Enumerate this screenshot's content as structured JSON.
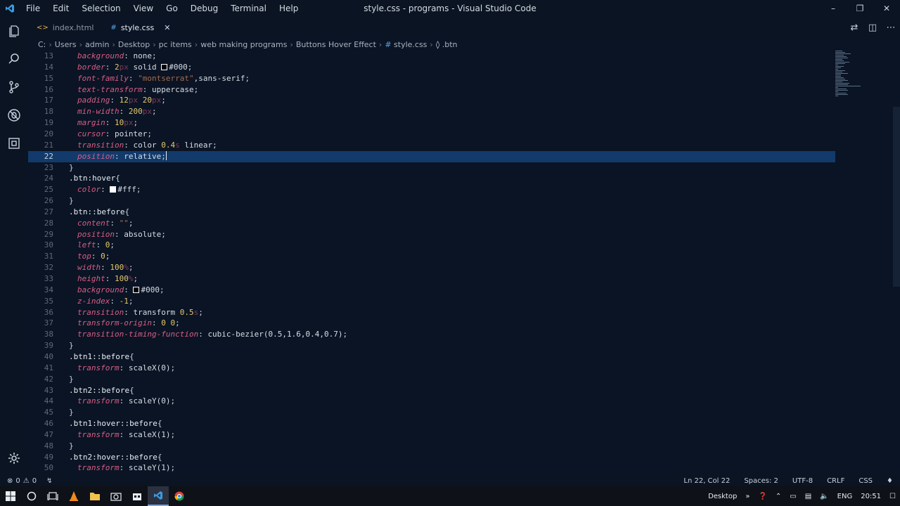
{
  "window": {
    "title": "style.css - programs - Visual Studio Code",
    "menu": [
      "File",
      "Edit",
      "Selection",
      "View",
      "Go",
      "Debug",
      "Terminal",
      "Help"
    ]
  },
  "tabs": [
    {
      "label": "index.html",
      "icon": "html-file-icon"
    },
    {
      "label": "style.css",
      "icon": "css-file-icon",
      "active": true
    }
  ],
  "breadcrumb": [
    "C:",
    "Users",
    "admin",
    "Desktop",
    "pc items",
    "web making programs",
    "Buttons Hover Effect",
    "style.css",
    ".btn"
  ],
  "editor": {
    "lines": [
      {
        "n": "13",
        "ind": 1,
        "t": [
          [
            "p",
            "background"
          ],
          [
            "x",
            ": "
          ],
          [
            "v",
            "none"
          ],
          [
            "x",
            ";"
          ]
        ]
      },
      {
        "n": "14",
        "ind": 1,
        "t": [
          [
            "p",
            "border"
          ],
          [
            "x",
            ": "
          ],
          [
            "d",
            "2"
          ],
          [
            "u",
            "px"
          ],
          [
            "v",
            " solid "
          ],
          [
            "sw",
            "#000"
          ],
          [
            "v",
            "#000"
          ],
          [
            "x",
            ";"
          ]
        ]
      },
      {
        "n": "15",
        "ind": 1,
        "t": [
          [
            "p",
            "font-family"
          ],
          [
            "x",
            ": "
          ],
          [
            "s",
            "\"montserrat\""
          ],
          [
            "v",
            ",sans-serif"
          ],
          [
            "x",
            ";"
          ]
        ]
      },
      {
        "n": "16",
        "ind": 1,
        "t": [
          [
            "p",
            "text-transform"
          ],
          [
            "x",
            ": "
          ],
          [
            "v",
            "uppercase"
          ],
          [
            "x",
            ";"
          ]
        ]
      },
      {
        "n": "17",
        "ind": 1,
        "t": [
          [
            "p",
            "padding"
          ],
          [
            "x",
            ": "
          ],
          [
            "d",
            "12"
          ],
          [
            "u",
            "px"
          ],
          [
            "v",
            " "
          ],
          [
            "d",
            "20"
          ],
          [
            "u",
            "px"
          ],
          [
            "x",
            ";"
          ]
        ]
      },
      {
        "n": "18",
        "ind": 1,
        "t": [
          [
            "p",
            "min-width"
          ],
          [
            "x",
            ": "
          ],
          [
            "d",
            "200"
          ],
          [
            "u",
            "px"
          ],
          [
            "x",
            ";"
          ]
        ]
      },
      {
        "n": "19",
        "ind": 1,
        "t": [
          [
            "p",
            "margin"
          ],
          [
            "x",
            ": "
          ],
          [
            "d",
            "10"
          ],
          [
            "u",
            "px"
          ],
          [
            "x",
            ";"
          ]
        ]
      },
      {
        "n": "20",
        "ind": 1,
        "t": [
          [
            "p",
            "cursor"
          ],
          [
            "x",
            ": "
          ],
          [
            "v",
            "pointer"
          ],
          [
            "x",
            ";"
          ]
        ]
      },
      {
        "n": "21",
        "ind": 1,
        "t": [
          [
            "p",
            "transition"
          ],
          [
            "x",
            ": "
          ],
          [
            "v",
            "color "
          ],
          [
            "d",
            "0.4"
          ],
          [
            "u",
            "s"
          ],
          [
            "v",
            " linear"
          ],
          [
            "x",
            ";"
          ]
        ]
      },
      {
        "n": "22",
        "ind": 1,
        "current": true,
        "t": [
          [
            "p",
            "position"
          ],
          [
            "x",
            ": "
          ],
          [
            "v",
            "relative"
          ],
          [
            "x",
            ";"
          ],
          [
            "cur",
            ""
          ]
        ]
      },
      {
        "n": "23",
        "ind": 0,
        "t": [
          [
            "x",
            "}"
          ]
        ]
      },
      {
        "n": "24",
        "ind": 0,
        "t": [
          [
            "sel",
            ".btn:hover"
          ],
          [
            "x",
            "{"
          ]
        ]
      },
      {
        "n": "25",
        "ind": 1,
        "t": [
          [
            "p",
            "color"
          ],
          [
            "x",
            ": "
          ],
          [
            "sw",
            "#fff"
          ],
          [
            "v",
            "#fff"
          ],
          [
            "x",
            ";"
          ]
        ]
      },
      {
        "n": "26",
        "ind": 0,
        "t": [
          [
            "x",
            "}"
          ]
        ]
      },
      {
        "n": "27",
        "ind": 0,
        "t": [
          [
            "sel",
            ".btn::before"
          ],
          [
            "x",
            "{"
          ]
        ]
      },
      {
        "n": "28",
        "ind": 1,
        "t": [
          [
            "p",
            "content"
          ],
          [
            "x",
            ": "
          ],
          [
            "s",
            "\"\""
          ],
          [
            "x",
            ";"
          ]
        ]
      },
      {
        "n": "29",
        "ind": 1,
        "t": [
          [
            "p",
            "position"
          ],
          [
            "x",
            ": "
          ],
          [
            "v",
            "absolute"
          ],
          [
            "x",
            ";"
          ]
        ]
      },
      {
        "n": "30",
        "ind": 1,
        "t": [
          [
            "p",
            "left"
          ],
          [
            "x",
            ": "
          ],
          [
            "d",
            "0"
          ],
          [
            "x",
            ";"
          ]
        ]
      },
      {
        "n": "31",
        "ind": 1,
        "t": [
          [
            "p",
            "top"
          ],
          [
            "x",
            ": "
          ],
          [
            "d",
            "0"
          ],
          [
            "x",
            ";"
          ]
        ]
      },
      {
        "n": "32",
        "ind": 1,
        "t": [
          [
            "p",
            "width"
          ],
          [
            "x",
            ": "
          ],
          [
            "d",
            "100"
          ],
          [
            "u",
            "%"
          ],
          [
            "x",
            ";"
          ]
        ]
      },
      {
        "n": "33",
        "ind": 1,
        "t": [
          [
            "p",
            "height"
          ],
          [
            "x",
            ": "
          ],
          [
            "d",
            "100"
          ],
          [
            "u",
            "%"
          ],
          [
            "x",
            ";"
          ]
        ]
      },
      {
        "n": "34",
        "ind": 1,
        "t": [
          [
            "p",
            "background"
          ],
          [
            "x",
            ": "
          ],
          [
            "sw",
            "#000"
          ],
          [
            "v",
            "#000"
          ],
          [
            "x",
            ";"
          ]
        ]
      },
      {
        "n": "35",
        "ind": 1,
        "t": [
          [
            "p",
            "z-index"
          ],
          [
            "x",
            ": "
          ],
          [
            "d",
            "-1"
          ],
          [
            "x",
            ";"
          ]
        ]
      },
      {
        "n": "36",
        "ind": 1,
        "t": [
          [
            "p",
            "transition"
          ],
          [
            "x",
            ": "
          ],
          [
            "v",
            "transform "
          ],
          [
            "d",
            "0.5"
          ],
          [
            "u",
            "s"
          ],
          [
            "x",
            ";"
          ]
        ]
      },
      {
        "n": "37",
        "ind": 1,
        "t": [
          [
            "p",
            "transform-origin"
          ],
          [
            "x",
            ": "
          ],
          [
            "d",
            "0"
          ],
          [
            "v",
            " "
          ],
          [
            "d",
            "0"
          ],
          [
            "x",
            ";"
          ]
        ]
      },
      {
        "n": "38",
        "ind": 1,
        "t": [
          [
            "p",
            "transition-timing-function"
          ],
          [
            "x",
            ": "
          ],
          [
            "v",
            "cubic-bezier(0.5,1.6,0.4,0.7)"
          ],
          [
            "x",
            ";"
          ]
        ]
      },
      {
        "n": "39",
        "ind": 0,
        "t": [
          [
            "x",
            "}"
          ]
        ]
      },
      {
        "n": "40",
        "ind": 0,
        "t": [
          [
            "sel",
            ".btn1::before"
          ],
          [
            "x",
            "{"
          ]
        ]
      },
      {
        "n": "41",
        "ind": 1,
        "t": [
          [
            "p",
            "transform"
          ],
          [
            "x",
            ": "
          ],
          [
            "v",
            "scaleX(0)"
          ],
          [
            "x",
            ";"
          ]
        ]
      },
      {
        "n": "42",
        "ind": 0,
        "t": [
          [
            "x",
            "}"
          ]
        ]
      },
      {
        "n": "43",
        "ind": 0,
        "t": [
          [
            "sel",
            ".btn2::before"
          ],
          [
            "x",
            "{"
          ]
        ]
      },
      {
        "n": "44",
        "ind": 1,
        "t": [
          [
            "p",
            "transform"
          ],
          [
            "x",
            ": "
          ],
          [
            "v",
            "scaleY(0)"
          ],
          [
            "x",
            ";"
          ]
        ]
      },
      {
        "n": "45",
        "ind": 0,
        "t": [
          [
            "x",
            "}"
          ]
        ]
      },
      {
        "n": "46",
        "ind": 0,
        "t": [
          [
            "sel",
            ".btn1:hover::before"
          ],
          [
            "x",
            "{"
          ]
        ]
      },
      {
        "n": "47",
        "ind": 1,
        "t": [
          [
            "p",
            "transform"
          ],
          [
            "x",
            ": "
          ],
          [
            "v",
            "scaleX(1)"
          ],
          [
            "x",
            ";"
          ]
        ]
      },
      {
        "n": "48",
        "ind": 0,
        "t": [
          [
            "x",
            "}"
          ]
        ]
      },
      {
        "n": "49",
        "ind": 0,
        "t": [
          [
            "sel",
            ".btn2:hover::before"
          ],
          [
            "x",
            "{"
          ]
        ]
      },
      {
        "n": "50",
        "ind": 1,
        "t": [
          [
            "p",
            "transform"
          ],
          [
            "x",
            ": "
          ],
          [
            "v",
            "scaleY(1)"
          ],
          [
            "x",
            ";"
          ]
        ]
      }
    ]
  },
  "status": {
    "errors": "0",
    "warnings": "0",
    "position": "Ln 22, Col 22",
    "spaces": "Spaces: 2",
    "encoding": "UTF-8",
    "eol": "CRLF",
    "language": "CSS"
  },
  "taskbar": {
    "desktop_label": "Desktop",
    "language": "ENG",
    "time": "20:51"
  },
  "colors": {
    "editor_bg": "#0a1424",
    "current_line": "#123a6b",
    "property": "#d95d86",
    "number": "#e7c96b",
    "accent": "#007acc"
  }
}
